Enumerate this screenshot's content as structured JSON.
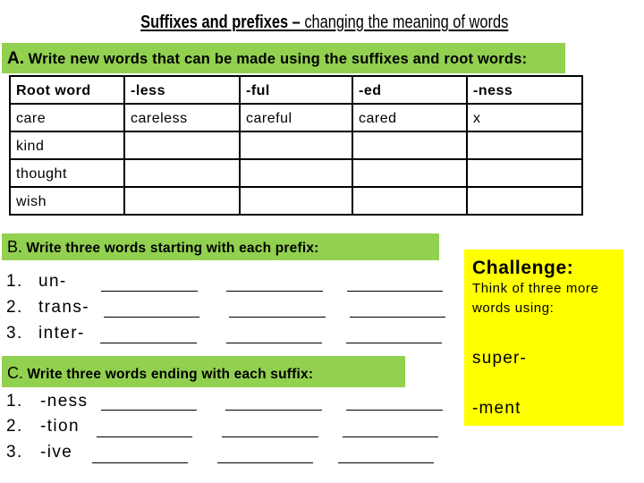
{
  "title": {
    "bold": "Suffixes and prefixes –",
    "regular": "changing the meaning of words"
  },
  "section_a": {
    "letter": "A.",
    "instruction": "Write new words that can be made using the suffixes and root words:",
    "table": {
      "headers": [
        "Root word",
        "-less",
        "-ful",
        "-ed",
        "-ness"
      ],
      "rows": [
        [
          "care",
          "careless",
          "careful",
          "cared",
          "x"
        ],
        [
          "kind",
          "",
          "",
          "",
          ""
        ],
        [
          "thought",
          "",
          "",
          "",
          ""
        ],
        [
          "wish",
          "",
          "",
          "",
          ""
        ]
      ]
    }
  },
  "section_b": {
    "letter": "B.",
    "instruction": "Write three words starting with each prefix:",
    "items": [
      {
        "number": "1.",
        "label": "un-"
      },
      {
        "number": "2.",
        "label": "trans-"
      },
      {
        "number": "3.",
        "label": "inter-"
      }
    ]
  },
  "section_c": {
    "letter": "C.",
    "instruction": "Write three words ending with each suffix:",
    "items": [
      {
        "number": "1.",
        "label": "-ness"
      },
      {
        "number": "2.",
        "label": "-tion"
      },
      {
        "number": "3.",
        "label": "-ive"
      }
    ]
  },
  "challenge": {
    "title": "Challenge:",
    "text_lines": [
      "Think of three more",
      "words using:"
    ],
    "items": [
      "super-",
      "-ment"
    ]
  },
  "colors": {
    "section_bar": "#92D050",
    "challenge_bg": "#FFFF00",
    "text": "#000000"
  }
}
